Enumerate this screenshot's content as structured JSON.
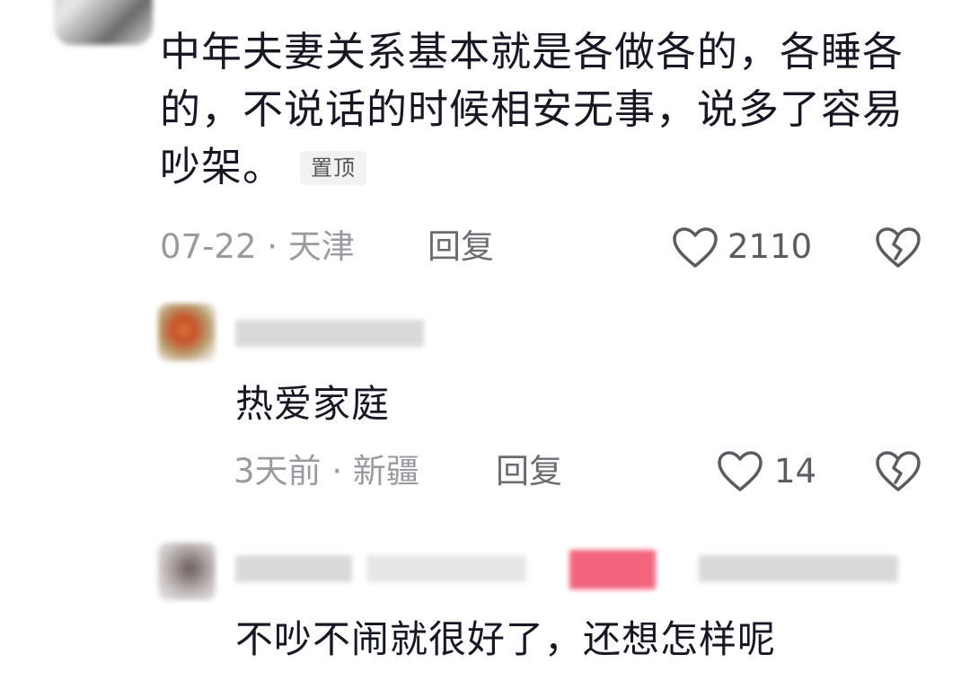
{
  "comments": [
    {
      "text": "中年夫妻关系基本就是各做各的，各睡各的，不说话的时候相安无事，说多了容易吵架。",
      "badge": "置顶",
      "date": "07-22",
      "separator": "·",
      "location": "天津",
      "reply_label": "回复",
      "likes": "2110",
      "like_icon": "heart-outline-icon",
      "dislike_icon": "broken-heart-icon"
    }
  ],
  "replies": [
    {
      "text": "热爱家庭",
      "date": "3天前",
      "separator": "·",
      "location": "新疆",
      "reply_label": "回复",
      "likes": "14",
      "like_icon": "heart-outline-icon",
      "dislike_icon": "broken-heart-icon"
    },
    {
      "text": "不吵不闹就很好了，还想怎样呢"
    }
  ],
  "colors": {
    "text": "#161823",
    "meta": "#9a9ba0",
    "badge_bg": "#f2f2f4",
    "icon": "#5b5c62",
    "author_tag": "#f2657d"
  }
}
